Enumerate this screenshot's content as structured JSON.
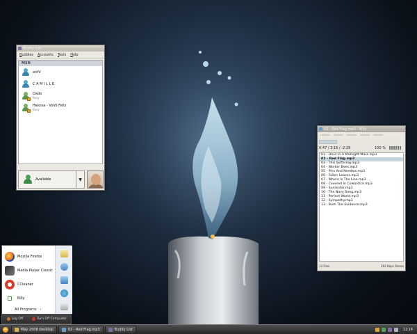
{
  "buddy_window": {
    "title": "Buddy List",
    "menu": [
      "Buddies",
      "Accounts",
      "Tools",
      "Help"
    ],
    "group_name": "MSN",
    "buddies": [
      {
        "name": "antV",
        "status": ""
      },
      {
        "name": "CAMILLE",
        "status": ""
      },
      {
        "name": "Dado",
        "status": "Busy"
      },
      {
        "name": "Heloisa - VoVó Feliz",
        "status": "Busy"
      }
    ],
    "status": {
      "label": "Available",
      "dropdown_glyph": "▼"
    }
  },
  "player_window": {
    "title": "02 - Red Flag.mp3 - Billy",
    "time_display": "0:47 / 3:16 / -2:29",
    "volume_text": "100 %",
    "tracks": [
      "01 - Devil In A Midnight Mass.mp3",
      "02 - Red Flag.mp3",
      "03 - This Suffering.mp3",
      "04 - Worker Bees.mp3",
      "05 - Pins And Needles.mp3",
      "06 - Fallen Leaves.mp3",
      "07 - Where Is The Line.mp3",
      "08 - Covered In Cowardice.mp3",
      "09 - Surrender.mp3",
      "10 - The Navy Song.mp3",
      "11 - Perfect World.mp3",
      "12 - Sympathy.mp3",
      "13 - Burn The Evidence.mp3"
    ],
    "active_track_index": 1,
    "file_count": "13 Files",
    "bitrate": "262 Kbps Stereo"
  },
  "start_menu": {
    "programs": [
      {
        "label": "Mozilla Firefox",
        "icon": "firefox-icon"
      },
      {
        "label": "Media Player Classic",
        "icon": "media-player-icon"
      },
      {
        "label": "CCleaner",
        "icon": "ccleaner-icon"
      },
      {
        "label": "Billy",
        "icon": "billy-icon"
      }
    ],
    "all_programs": "All Programs",
    "all_programs_arrow": "›",
    "log_off": "Log Off",
    "turn_off": "Turn Off Computer"
  },
  "taskbar": {
    "tasks": [
      {
        "label": "May 2008 Desktop",
        "color": "#d8b24a"
      },
      {
        "label": "02 - Red Flag.mp3",
        "color": "#6a9bc4"
      },
      {
        "label": "Buddy List",
        "color": "#7a6fa0"
      }
    ],
    "clock": "11:14"
  },
  "colors": {
    "playlist_highlight": "#c4d6db",
    "taskbar": "#3a3a3a"
  }
}
